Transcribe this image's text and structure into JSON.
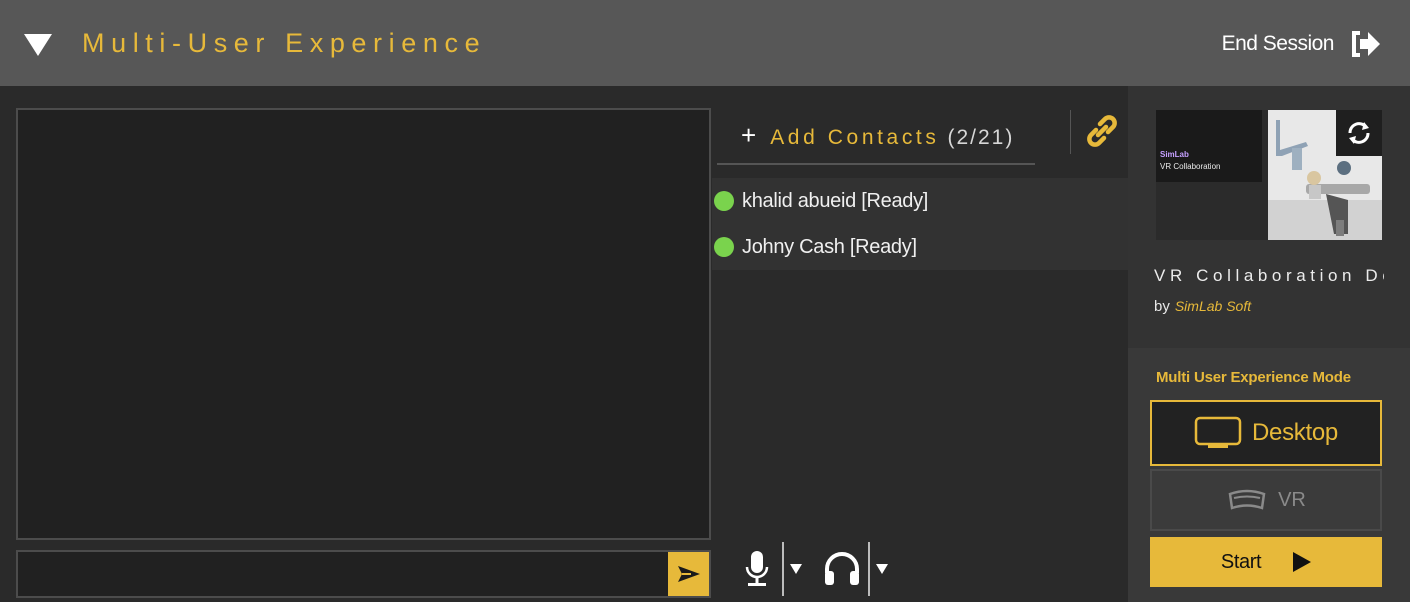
{
  "header": {
    "title": "Multi-User Experience",
    "end_session_label": "End Session",
    "collapse_icon": "triangle-down-icon",
    "end_session_icon": "exit-arrow-icon"
  },
  "chat": {
    "input_value": "",
    "input_placeholder": "",
    "send_icon": "send-arrow-icon"
  },
  "contacts": {
    "add_label": "Add Contacts",
    "count": "(2/21)",
    "plus_symbol": "+",
    "link_icon": "link-icon",
    "items": [
      {
        "name": "khalid abueid [Ready]",
        "status": "online"
      },
      {
        "name": "Johny Cash [Ready]",
        "status": "online"
      }
    ]
  },
  "voice": {
    "mic_icon": "microphone-icon",
    "headphones_icon": "headphones-icon",
    "dropdown_icon": "chevron-down-icon"
  },
  "scene": {
    "thumb_brand": "SimLab",
    "thumb_subtitle": "VR Collaboration",
    "title": "VR Collaboration De",
    "by_label": "by",
    "author": "SimLab Soft",
    "refresh_icon": "refresh-icon"
  },
  "mode": {
    "title": "Multi User Experience Mode",
    "desktop_label": "Desktop",
    "vr_label": "VR",
    "start_label": "Start",
    "selected": "Desktop"
  },
  "colors": {
    "accent": "#e7b93a",
    "header_bg": "#575757",
    "panel_bg": "#2a2a2a",
    "online": "#7ad34d"
  }
}
